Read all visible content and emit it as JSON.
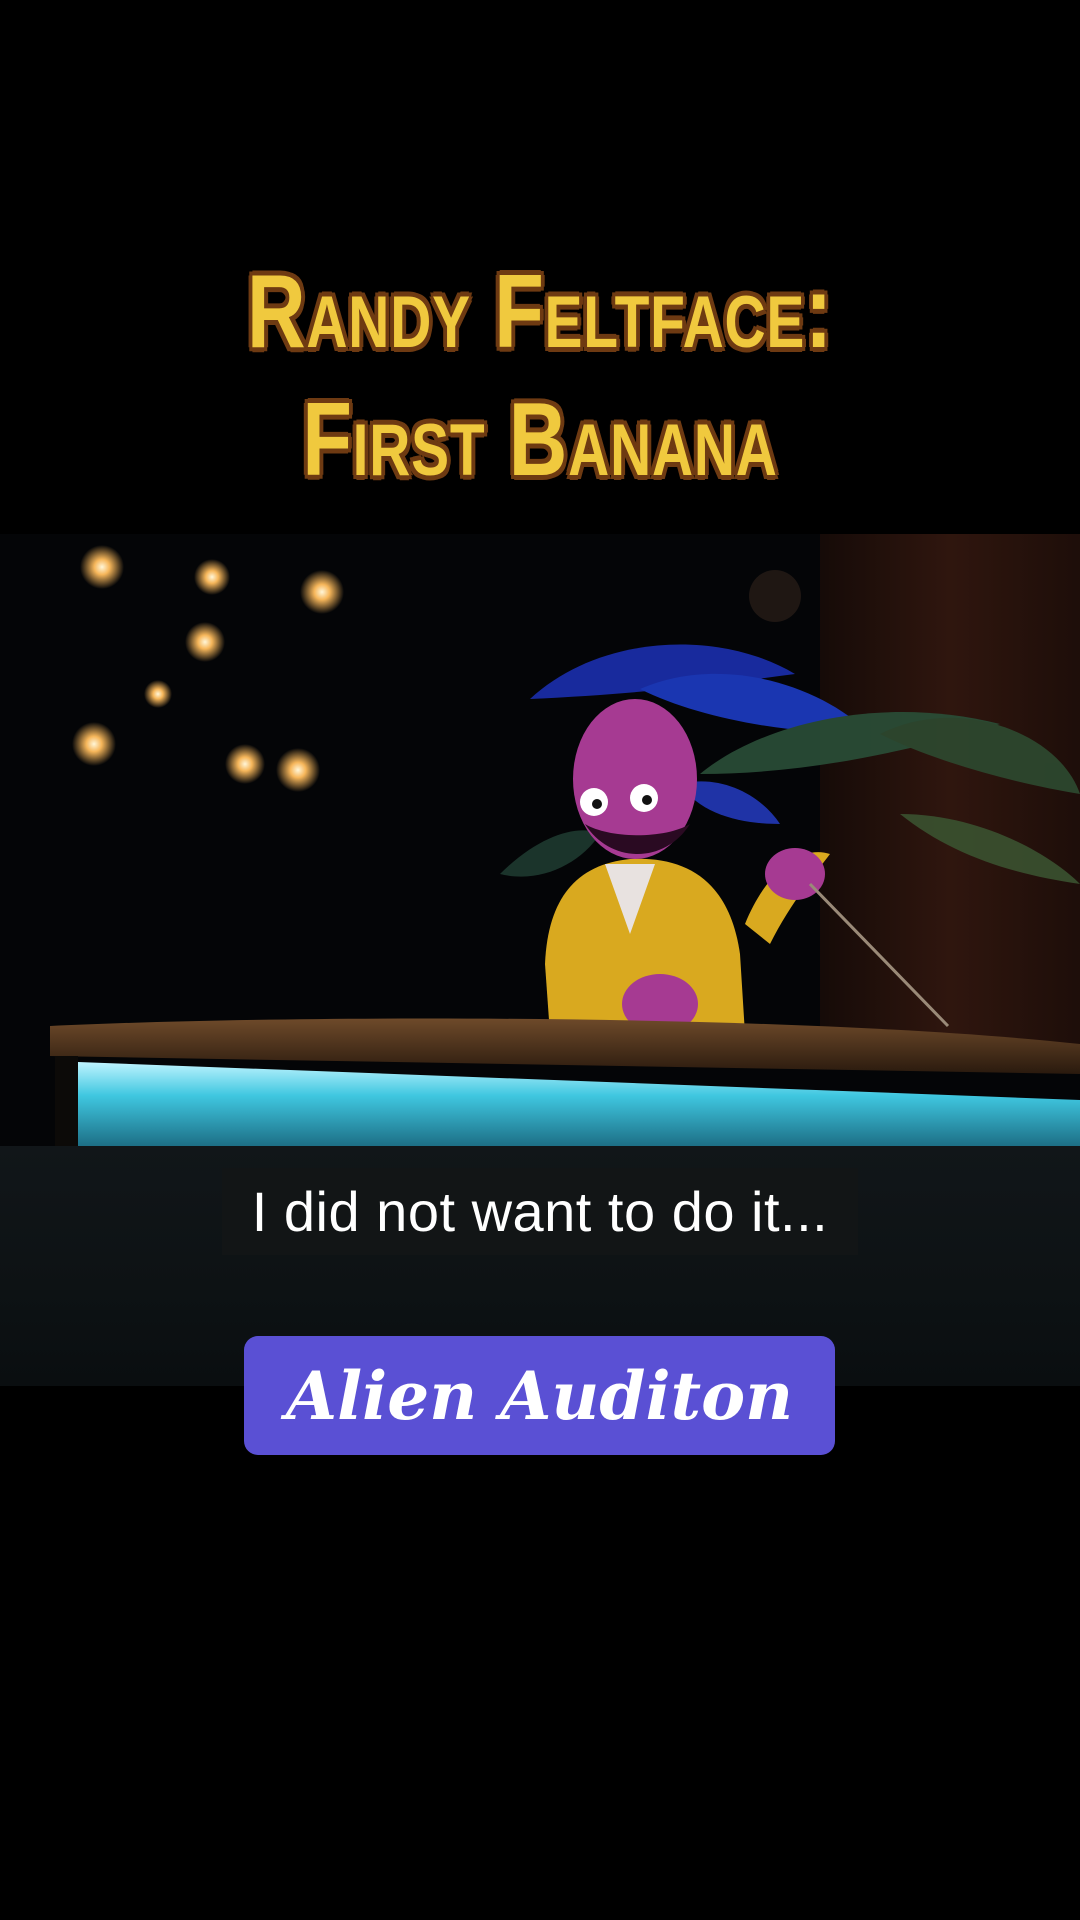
{
  "title": {
    "line1": "Randy Feltface:",
    "line2": "First Banana"
  },
  "video": {
    "subtitle": "I did not want to do it..."
  },
  "action": {
    "label": "Alien Auditon"
  },
  "colors": {
    "title_fill": "#f0c93e",
    "title_outline": "#6e3a12",
    "button_bg": "#5a50d4",
    "background": "#000000"
  }
}
